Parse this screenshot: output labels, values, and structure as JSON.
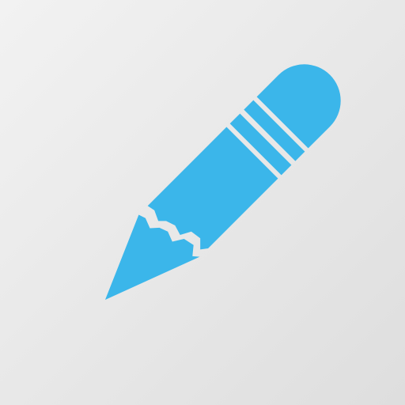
{
  "icon": {
    "name": "pencil-icon",
    "color": "#3bb6ea",
    "band_color": "#e6e6e6"
  },
  "background": {
    "color_start": "#f2f2f2",
    "color_end": "#dedede"
  }
}
